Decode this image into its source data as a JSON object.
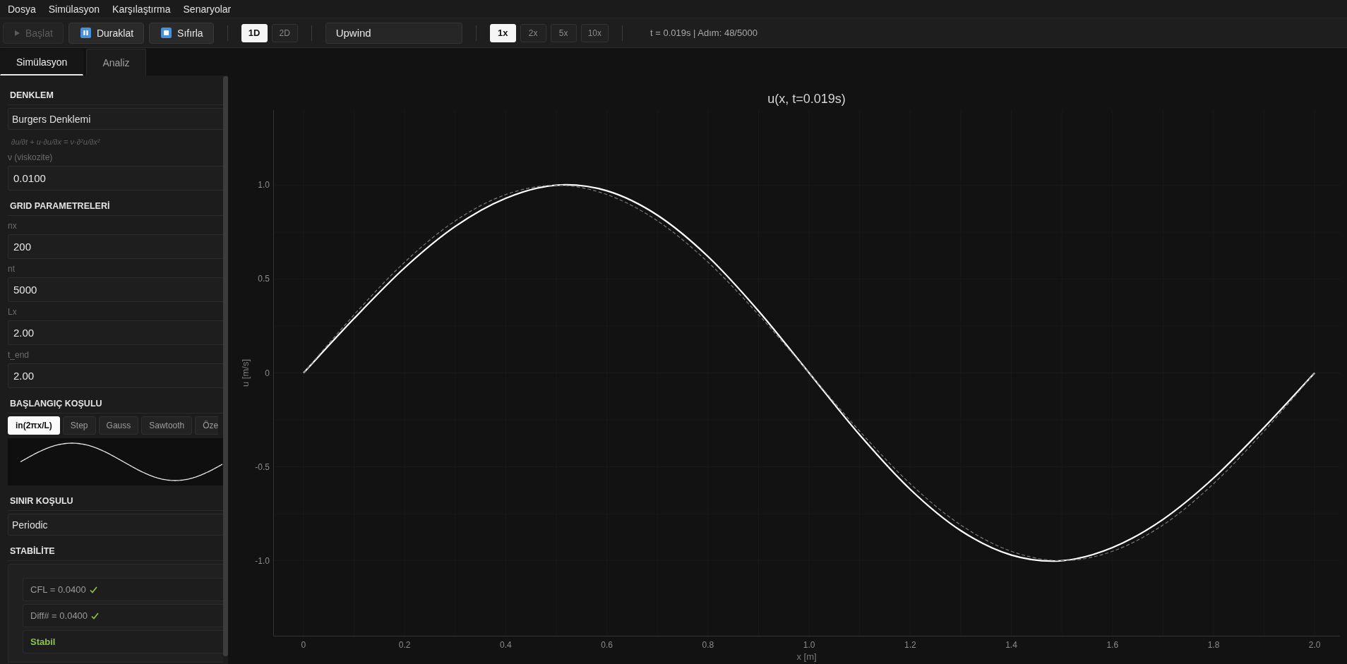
{
  "menu_bar": {
    "items": [
      "Dosya",
      "Simülasyon",
      "Karşılaştırma",
      "Senaryolar"
    ]
  },
  "toolbar": {
    "run_buttons": [
      {
        "kind": "play",
        "label": "Başlat",
        "disabled": true
      },
      {
        "kind": "pause",
        "label": "Duraklat",
        "disabled": false
      },
      {
        "kind": "stop",
        "label": "Sıfırla",
        "disabled": false
      }
    ],
    "dimension_toggle": [
      {
        "label": "1D",
        "selected": true
      },
      {
        "label": "2D",
        "selected": false
      }
    ],
    "scheme_select": {
      "value": "Upwind"
    },
    "speed_toggle": [
      {
        "label": "1x",
        "selected": true
      },
      {
        "label": "2x",
        "selected": false
      },
      {
        "label": "5x",
        "selected": false
      },
      {
        "label": "10x",
        "selected": false
      }
    ],
    "status": "t = 0.019s | Adım: 48/5000"
  },
  "sidebar": {
    "tabs": [
      {
        "label": "Simülasyon",
        "selected": true
      },
      {
        "label": "Analiz",
        "selected": false
      }
    ],
    "sections": [
      {
        "title": "DENKLEM",
        "items": [
          {
            "kind": "dropdown",
            "value": "Burgers Denklemi"
          },
          {
            "kind": "formula",
            "text": "∂u/∂t + u·∂u/∂x = ν·∂²u/∂x²"
          },
          {
            "kind": "field",
            "label": "ν (viskozite)",
            "value": "0.0100"
          }
        ]
      },
      {
        "title": "GRID PARAMETRELERİ",
        "items": [
          {
            "kind": "field",
            "label": "nx",
            "value": "200"
          },
          {
            "kind": "field",
            "label": "nt",
            "value": "5000"
          },
          {
            "kind": "field",
            "label": "Lx",
            "value": "2.00"
          },
          {
            "kind": "field",
            "label": "t_end",
            "value": "2.00"
          }
        ]
      },
      {
        "title": "BAŞLANGIÇ KOŞULU",
        "items": [
          {
            "kind": "presets",
            "options": [
              {
                "label": "in(2πx/L)",
                "selected": true
              },
              {
                "label": "Step",
                "selected": false
              },
              {
                "label": "Gauss",
                "selected": false
              },
              {
                "label": "Sawtooth",
                "selected": false
              },
              {
                "label": "Öze",
                "selected": false
              }
            ]
          },
          {
            "kind": "waveform_preview"
          }
        ]
      },
      {
        "title": "SINIR KOŞULU",
        "items": [
          {
            "kind": "dropdown",
            "value": "Periodic"
          }
        ]
      },
      {
        "title": "STABİLİTE",
        "items": [
          {
            "kind": "stability",
            "checks": [
              {
                "text": "CFL = 0.0400",
                "ok": true
              },
              {
                "text": "Diff# = 0.0400",
                "ok": true
              }
            ],
            "verdict": {
              "text": "Stabil",
              "stable": true
            }
          }
        ]
      }
    ]
  },
  "plot": {
    "chart_data": {
      "type": "line",
      "title": "u(x, t=0.019s)",
      "xlabel": "x [m]",
      "ylabel": "u [m/s]",
      "x": [
        0,
        0.1,
        0.2,
        0.3,
        0.4,
        0.5,
        0.6,
        0.7,
        0.8,
        0.9,
        1,
        1.1,
        1.2,
        1.3,
        1.4,
        1.5,
        1.6,
        1.7,
        1.8,
        1.9,
        2
      ],
      "series": [
        {
          "color": "#ffffff",
          "line_style": "solid",
          "values": [
            0,
            0.29,
            0.56,
            0.78,
            0.93,
            1,
            0.97,
            0.84,
            0.62,
            0.33,
            0,
            -0.33,
            -0.62,
            -0.84,
            -0.97,
            -1,
            -0.93,
            -0.78,
            -0.56,
            -0.29,
            0
          ]
        },
        {
          "color": "#7a7a7a",
          "line_style": "dashed",
          "values": [
            0,
            0.31,
            0.59,
            0.81,
            0.95,
            1,
            0.95,
            0.81,
            0.59,
            0.31,
            0,
            -0.31,
            -0.59,
            -0.81,
            -0.95,
            -1,
            -0.95,
            -0.81,
            -0.59,
            -0.31,
            0
          ]
        }
      ],
      "xlim": [
        -0.06,
        2.05
      ],
      "ylim": [
        -1.4,
        1.4
      ],
      "xticks": [
        0,
        0.2,
        0.4,
        0.6,
        0.8,
        {
          "value": 1,
          "label": "1.0"
        },
        1.2,
        1.4,
        1.6,
        1.8,
        {
          "value": 2,
          "label": "2.0"
        }
      ],
      "yticks": [
        {
          "value": -1,
          "label": "-1.0"
        },
        -0.5,
        0,
        0.5,
        {
          "value": 1,
          "label": "1.0"
        }
      ],
      "grid": true
    }
  }
}
